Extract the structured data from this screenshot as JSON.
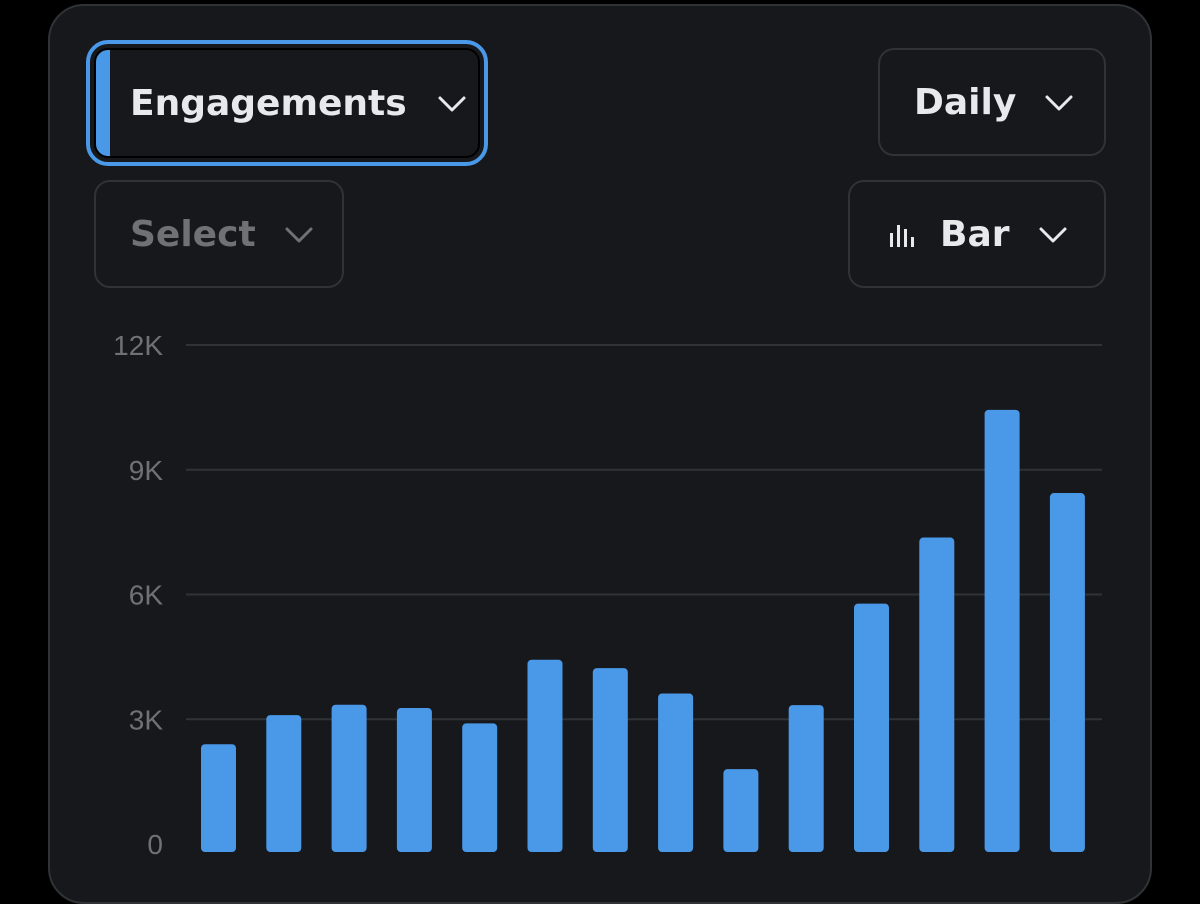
{
  "controls": {
    "metric_dropdown": {
      "label": "Engagements",
      "icon": "chevron-down-icon"
    },
    "interval_dropdown": {
      "label": "Daily",
      "icon": "chevron-down-icon"
    },
    "filter_dropdown": {
      "label": "Select",
      "icon": "chevron-down-icon"
    },
    "chart_type_dropdown": {
      "label": "Bar",
      "icon": "bar-chart-icon"
    }
  },
  "colors": {
    "background": "#16181c",
    "accent": "#4a99e9",
    "bar": "#4a99e9",
    "gridline": "#2f3336",
    "muted_text": "#6e7275",
    "text": "#e7e9ea"
  },
  "chart_data": {
    "type": "bar",
    "title": "",
    "xlabel": "",
    "ylabel": "",
    "ylim": [
      0,
      12000
    ],
    "yticks": [
      0,
      3000,
      6000,
      9000,
      12000
    ],
    "ytick_labels": [
      "0",
      "3K",
      "6K",
      "9K",
      "12K"
    ],
    "grid": true,
    "values": [
      2400,
      3100,
      3350,
      3270,
      2900,
      4430,
      4230,
      3620,
      1800,
      3340,
      5780,
      7370,
      10440,
      8440
    ]
  }
}
